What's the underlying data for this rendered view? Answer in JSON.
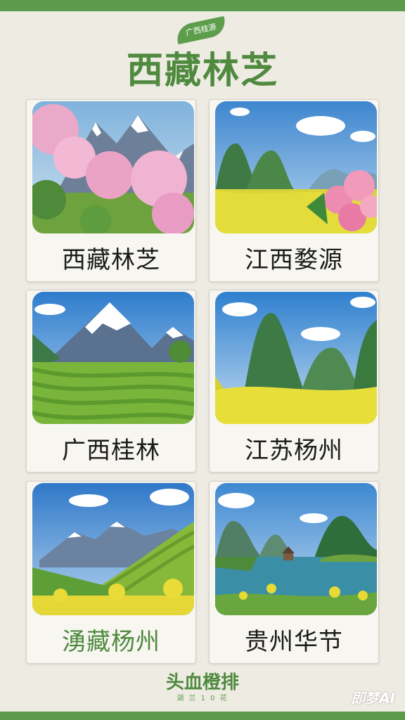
{
  "header": {
    "tag": "广西桂源",
    "title": "西藏林芝"
  },
  "cards": [
    {
      "label": "西藏林芝",
      "scene": "mountain-peach-blossom"
    },
    {
      "label": "江西婺源",
      "scene": "karst-rapeseed-flowers"
    },
    {
      "label": "广西桂林",
      "scene": "snow-mountain-terraces"
    },
    {
      "label": "江苏杨州",
      "scene": "karst-rapeseed-field"
    },
    {
      "label": "湧藏杨州",
      "scene": "terraces-rapeseed"
    },
    {
      "label": "贵州华节",
      "scene": "karst-lake-pavilion"
    }
  ],
  "footer": {
    "title": "头血橙排",
    "subtitle": "湖 兰 1 0 花"
  },
  "watermark": "即梦AI",
  "colors": {
    "frame": "#5a9a4a",
    "title": "#4f8a3f",
    "background": "#eeebe3"
  }
}
